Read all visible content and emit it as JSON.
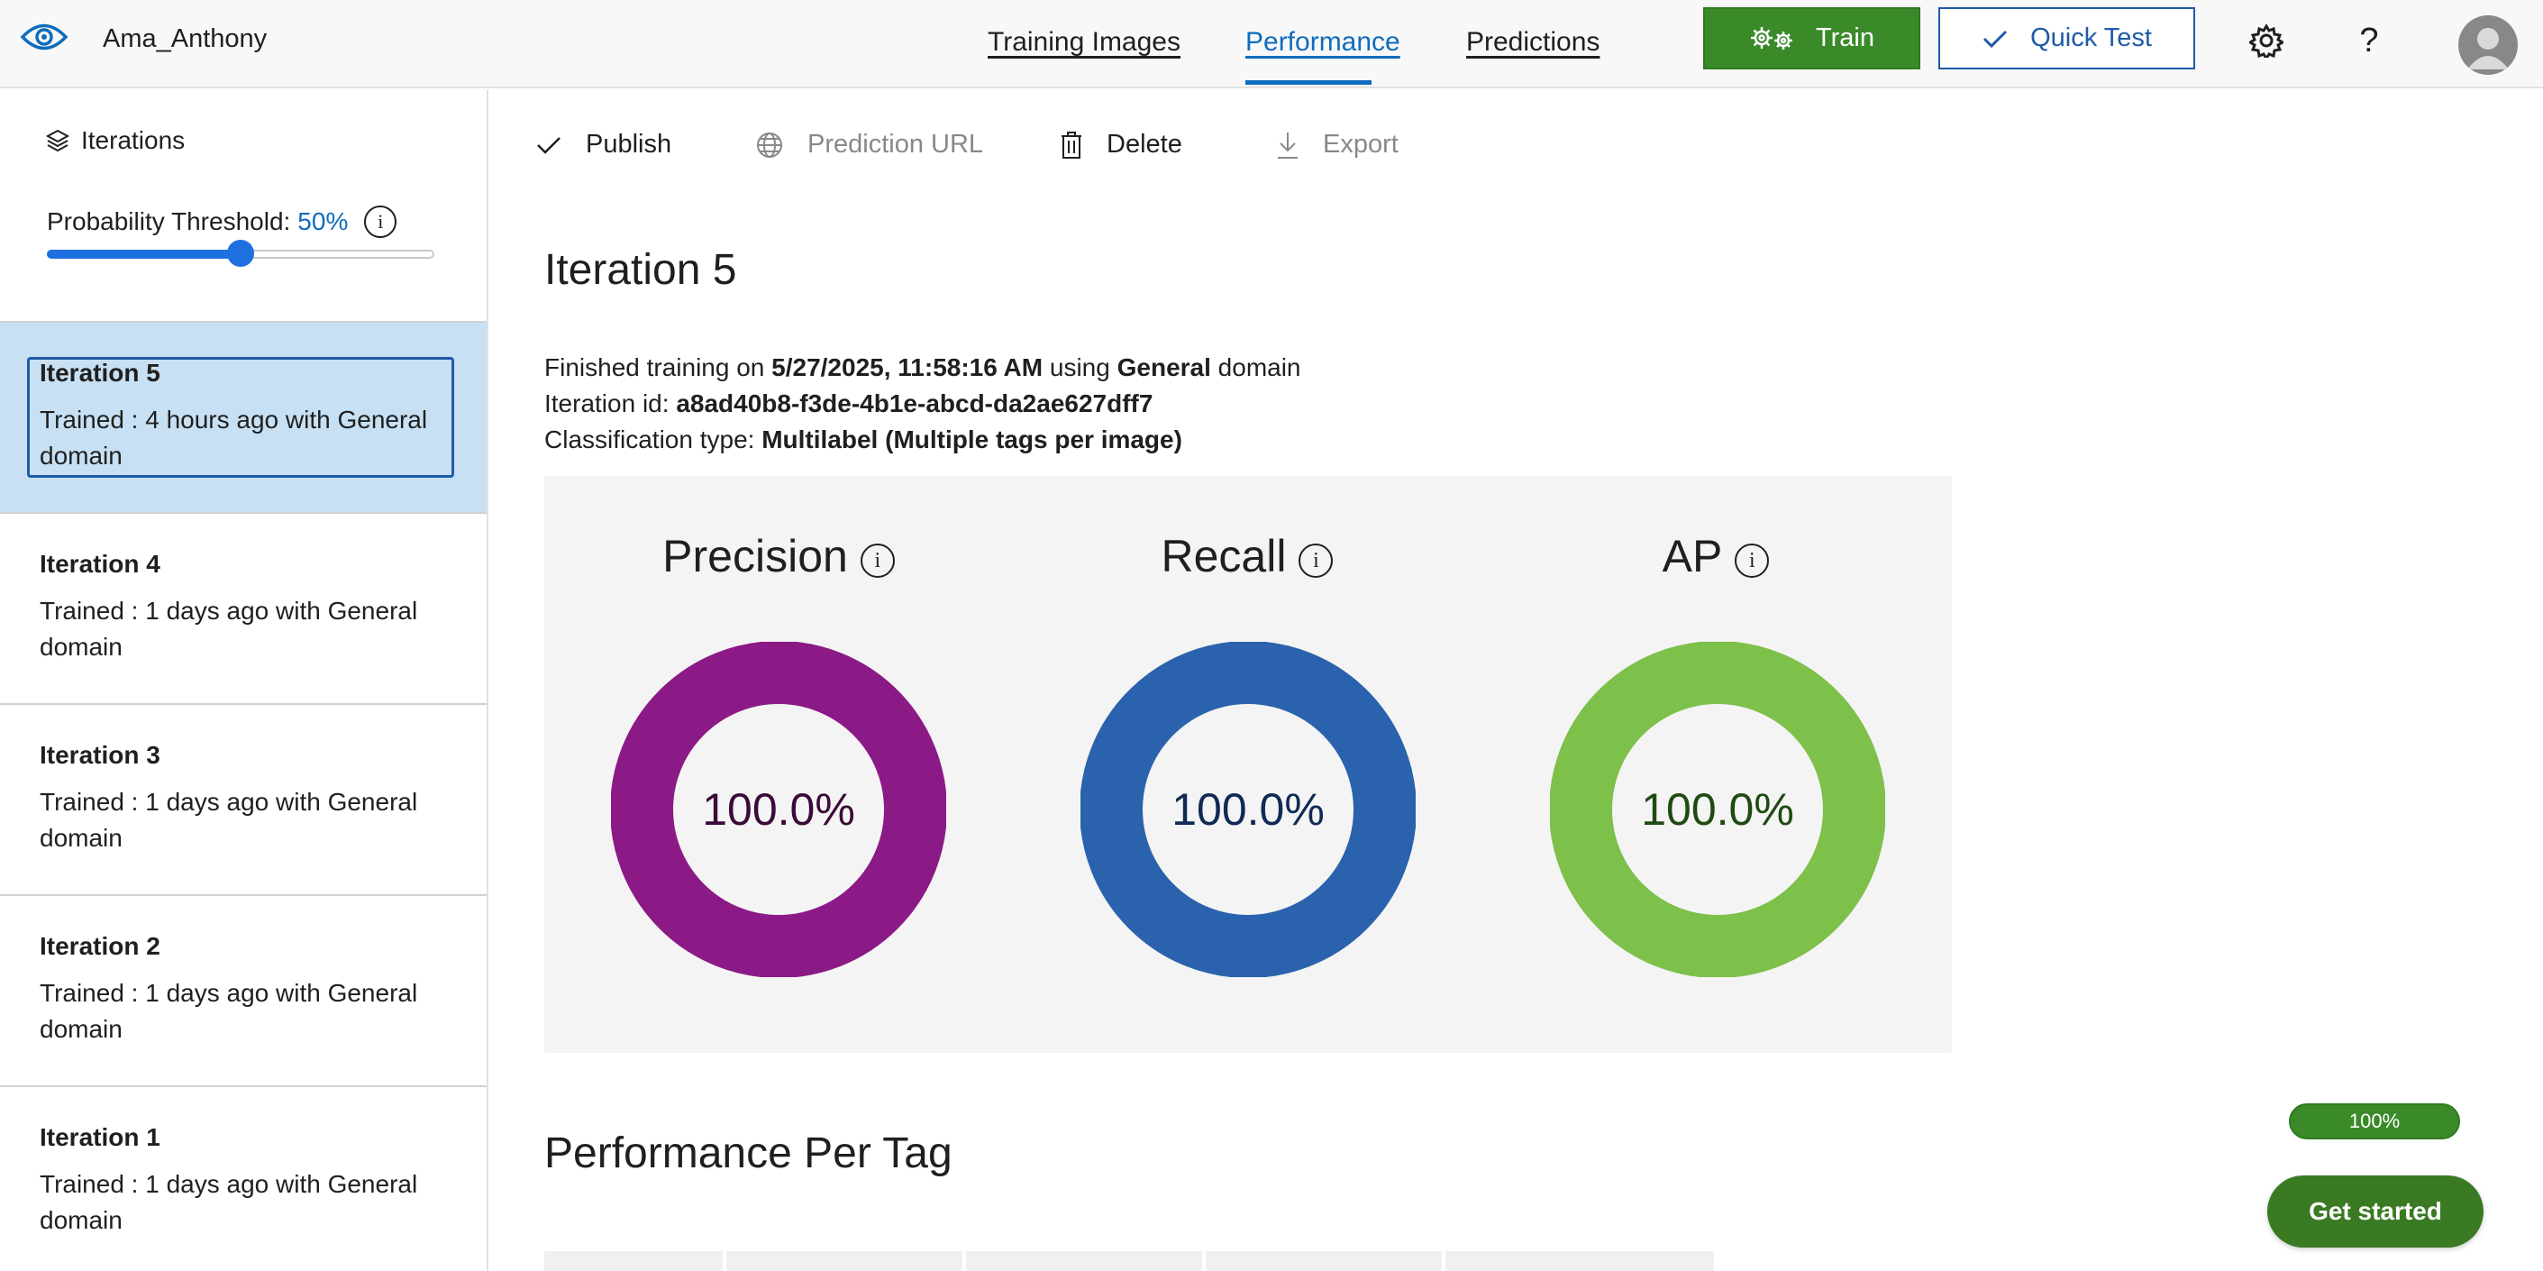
{
  "header": {
    "logo_icon": "eye-icon",
    "project_name": "Ama_Anthony",
    "tabs": [
      {
        "label": "Training Images"
      },
      {
        "label": "Performance"
      },
      {
        "label": "Predictions"
      }
    ],
    "active_tab": "Performance",
    "train_label": "Train",
    "quick_test_label": "Quick Test",
    "accent": "#0f6cbd",
    "train_color": "#3a8a2a"
  },
  "sidebar": {
    "heading": "Iterations",
    "threshold_label": "Probability Threshold:",
    "threshold_value": "50%",
    "threshold_fraction": 0.5,
    "iterations": [
      {
        "title": "Iteration 5",
        "desc": "Trained : 4 hours ago with General domain"
      },
      {
        "title": "Iteration 4",
        "desc": "Trained : 1 days ago with General domain"
      },
      {
        "title": "Iteration 3",
        "desc": "Trained : 1 days ago with General domain"
      },
      {
        "title": "Iteration 2",
        "desc": "Trained : 1 days ago with General domain"
      },
      {
        "title": "Iteration 1",
        "desc": "Trained : 1 days ago with General domain"
      }
    ]
  },
  "toolbar": {
    "publish": "Publish",
    "prediction_url": "Prediction URL",
    "delete": "Delete",
    "export": "Export"
  },
  "main": {
    "iteration_title": "Iteration 5",
    "finished_prefix": "Finished training on ",
    "finished_date": "5/27/2025, 11:58:16 AM",
    "finished_mid": " using ",
    "finished_domain": "General",
    "finished_suffix": " domain",
    "id_prefix": "Iteration id: ",
    "iteration_id": "a8ad40b8-f3de-4b1e-abcd-da2ae627dff7",
    "class_prefix": "Classification type: ",
    "class_type": "Multilabel (Multiple tags per image)",
    "metrics": [
      {
        "label": "Precision",
        "value": "100.0%",
        "fraction": 1.0,
        "color": "#8b1a86",
        "text_color": "#3b0a38"
      },
      {
        "label": "Recall",
        "value": "100.0%",
        "fraction": 1.0,
        "color": "#2a62ad",
        "text_color": "#0f2a55"
      },
      {
        "label": "AP",
        "value": "100.0%",
        "fraction": 1.0,
        "color": "#7dc04a",
        "text_color": "#1f4a12"
      }
    ],
    "perf_per_tag": "Performance Per Tag"
  },
  "footer": {
    "progress_label": "100%",
    "progress_fraction": 1.0,
    "get_started": "Get started"
  }
}
